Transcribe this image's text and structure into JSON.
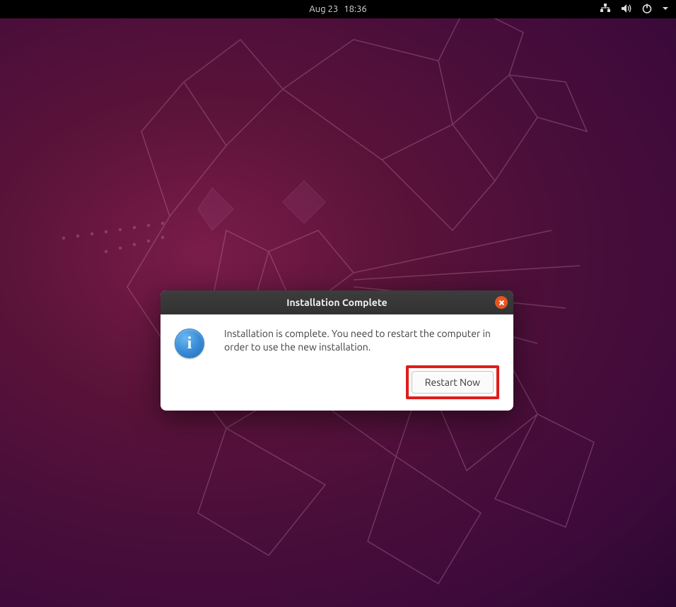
{
  "topbar": {
    "date": "Aug 23",
    "time": "18:36"
  },
  "dialog": {
    "title": "Installation Complete",
    "message": "Installation is complete. You need to restart the computer in order to use the new installation.",
    "button_label": "Restart Now",
    "info_glyph": "i"
  }
}
